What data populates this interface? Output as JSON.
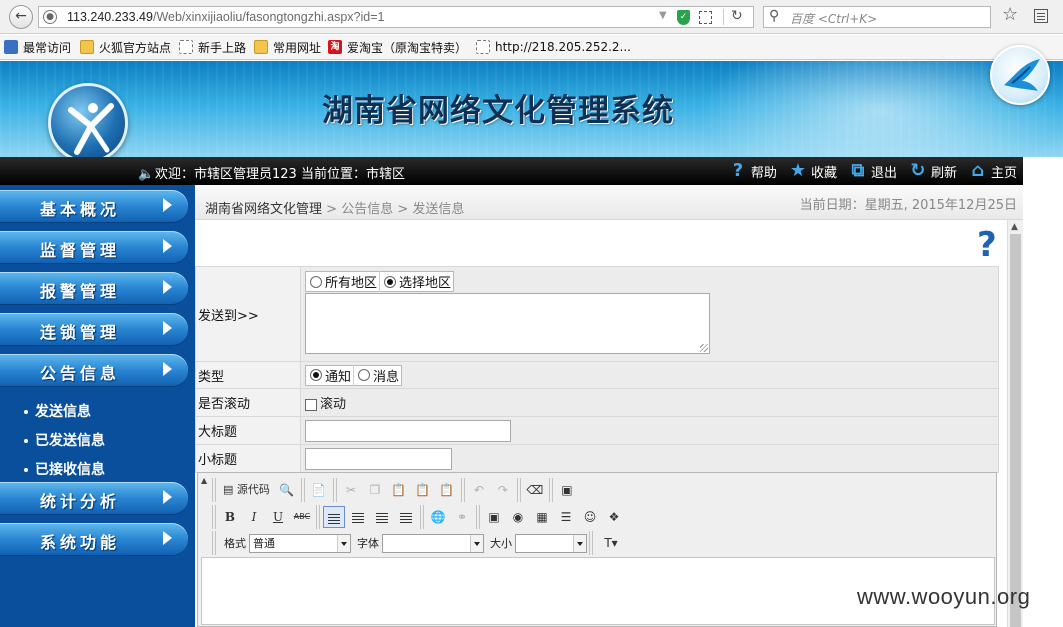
{
  "browser": {
    "url_host": "113.240.233.49",
    "url_path": "/Web/xinxijiaoliu/fasongtongzhi.aspx?id=1",
    "search_placeholder": "百度 <Ctrl+K>",
    "bookmarks": [
      "最常访问",
      "火狐官方站点",
      "新手上路",
      "常用网址",
      "爱淘宝（原淘宝特卖）",
      "http://218.205.252.2..."
    ]
  },
  "header": {
    "title": "湖南省网络文化管理系统"
  },
  "navbar": {
    "welcome": "欢迎：市辖区管理员123   当前位置：市辖区",
    "links": [
      "帮助",
      "收藏",
      "退出",
      "刷新",
      "主页"
    ]
  },
  "sidebar": {
    "menu": [
      "基本概况",
      "监督管理",
      "报警管理",
      "连锁管理",
      "公告信息",
      "统计分析",
      "系统功能"
    ],
    "sub_items": [
      "发送信息",
      "已发送信息",
      "已接收信息"
    ]
  },
  "breadcrumb": {
    "root": "湖南省网络文化管理",
    "sep": " > ",
    "level1": "公告信息",
    "level2": "发送信息",
    "date": "当前日期：星期五, 2015年12月25日"
  },
  "form": {
    "send_to_label": "发送到>>",
    "region_all": "所有地区",
    "region_select": "选择地区",
    "type_label": "类型",
    "type_notice": "通知",
    "type_message": "消息",
    "scroll_label": "是否滚动",
    "scroll_option": "滚动",
    "big_title_label": "大标题",
    "small_title_label": "小标题"
  },
  "editor": {
    "source_button": "源代码",
    "format_label": "格式",
    "format_value": "普通",
    "font_label": "字体",
    "size_label": "大小"
  },
  "watermark": "www.wooyun.org"
}
